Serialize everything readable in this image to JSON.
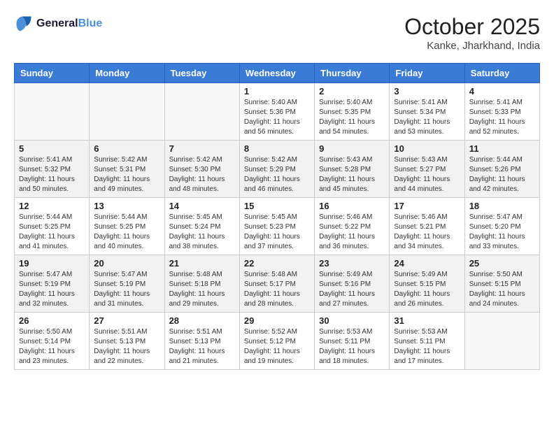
{
  "header": {
    "logo_line1": "General",
    "logo_line2": "Blue",
    "month": "October 2025",
    "location": "Kanke, Jharkhand, India"
  },
  "weekdays": [
    "Sunday",
    "Monday",
    "Tuesday",
    "Wednesday",
    "Thursday",
    "Friday",
    "Saturday"
  ],
  "weeks": [
    [
      {
        "day": "",
        "info": ""
      },
      {
        "day": "",
        "info": ""
      },
      {
        "day": "",
        "info": ""
      },
      {
        "day": "1",
        "info": "Sunrise: 5:40 AM\nSunset: 5:36 PM\nDaylight: 11 hours\nand 56 minutes."
      },
      {
        "day": "2",
        "info": "Sunrise: 5:40 AM\nSunset: 5:35 PM\nDaylight: 11 hours\nand 54 minutes."
      },
      {
        "day": "3",
        "info": "Sunrise: 5:41 AM\nSunset: 5:34 PM\nDaylight: 11 hours\nand 53 minutes."
      },
      {
        "day": "4",
        "info": "Sunrise: 5:41 AM\nSunset: 5:33 PM\nDaylight: 11 hours\nand 52 minutes."
      }
    ],
    [
      {
        "day": "5",
        "info": "Sunrise: 5:41 AM\nSunset: 5:32 PM\nDaylight: 11 hours\nand 50 minutes."
      },
      {
        "day": "6",
        "info": "Sunrise: 5:42 AM\nSunset: 5:31 PM\nDaylight: 11 hours\nand 49 minutes."
      },
      {
        "day": "7",
        "info": "Sunrise: 5:42 AM\nSunset: 5:30 PM\nDaylight: 11 hours\nand 48 minutes."
      },
      {
        "day": "8",
        "info": "Sunrise: 5:42 AM\nSunset: 5:29 PM\nDaylight: 11 hours\nand 46 minutes."
      },
      {
        "day": "9",
        "info": "Sunrise: 5:43 AM\nSunset: 5:28 PM\nDaylight: 11 hours\nand 45 minutes."
      },
      {
        "day": "10",
        "info": "Sunrise: 5:43 AM\nSunset: 5:27 PM\nDaylight: 11 hours\nand 44 minutes."
      },
      {
        "day": "11",
        "info": "Sunrise: 5:44 AM\nSunset: 5:26 PM\nDaylight: 11 hours\nand 42 minutes."
      }
    ],
    [
      {
        "day": "12",
        "info": "Sunrise: 5:44 AM\nSunset: 5:25 PM\nDaylight: 11 hours\nand 41 minutes."
      },
      {
        "day": "13",
        "info": "Sunrise: 5:44 AM\nSunset: 5:25 PM\nDaylight: 11 hours\nand 40 minutes."
      },
      {
        "day": "14",
        "info": "Sunrise: 5:45 AM\nSunset: 5:24 PM\nDaylight: 11 hours\nand 38 minutes."
      },
      {
        "day": "15",
        "info": "Sunrise: 5:45 AM\nSunset: 5:23 PM\nDaylight: 11 hours\nand 37 minutes."
      },
      {
        "day": "16",
        "info": "Sunrise: 5:46 AM\nSunset: 5:22 PM\nDaylight: 11 hours\nand 36 minutes."
      },
      {
        "day": "17",
        "info": "Sunrise: 5:46 AM\nSunset: 5:21 PM\nDaylight: 11 hours\nand 34 minutes."
      },
      {
        "day": "18",
        "info": "Sunrise: 5:47 AM\nSunset: 5:20 PM\nDaylight: 11 hours\nand 33 minutes."
      }
    ],
    [
      {
        "day": "19",
        "info": "Sunrise: 5:47 AM\nSunset: 5:19 PM\nDaylight: 11 hours\nand 32 minutes."
      },
      {
        "day": "20",
        "info": "Sunrise: 5:47 AM\nSunset: 5:19 PM\nDaylight: 11 hours\nand 31 minutes."
      },
      {
        "day": "21",
        "info": "Sunrise: 5:48 AM\nSunset: 5:18 PM\nDaylight: 11 hours\nand 29 minutes."
      },
      {
        "day": "22",
        "info": "Sunrise: 5:48 AM\nSunset: 5:17 PM\nDaylight: 11 hours\nand 28 minutes."
      },
      {
        "day": "23",
        "info": "Sunrise: 5:49 AM\nSunset: 5:16 PM\nDaylight: 11 hours\nand 27 minutes."
      },
      {
        "day": "24",
        "info": "Sunrise: 5:49 AM\nSunset: 5:15 PM\nDaylight: 11 hours\nand 26 minutes."
      },
      {
        "day": "25",
        "info": "Sunrise: 5:50 AM\nSunset: 5:15 PM\nDaylight: 11 hours\nand 24 minutes."
      }
    ],
    [
      {
        "day": "26",
        "info": "Sunrise: 5:50 AM\nSunset: 5:14 PM\nDaylight: 11 hours\nand 23 minutes."
      },
      {
        "day": "27",
        "info": "Sunrise: 5:51 AM\nSunset: 5:13 PM\nDaylight: 11 hours\nand 22 minutes."
      },
      {
        "day": "28",
        "info": "Sunrise: 5:51 AM\nSunset: 5:13 PM\nDaylight: 11 hours\nand 21 minutes."
      },
      {
        "day": "29",
        "info": "Sunrise: 5:52 AM\nSunset: 5:12 PM\nDaylight: 11 hours\nand 19 minutes."
      },
      {
        "day": "30",
        "info": "Sunrise: 5:53 AM\nSunset: 5:11 PM\nDaylight: 11 hours\nand 18 minutes."
      },
      {
        "day": "31",
        "info": "Sunrise: 5:53 AM\nSunset: 5:11 PM\nDaylight: 11 hours\nand 17 minutes."
      },
      {
        "day": "",
        "info": ""
      }
    ]
  ]
}
